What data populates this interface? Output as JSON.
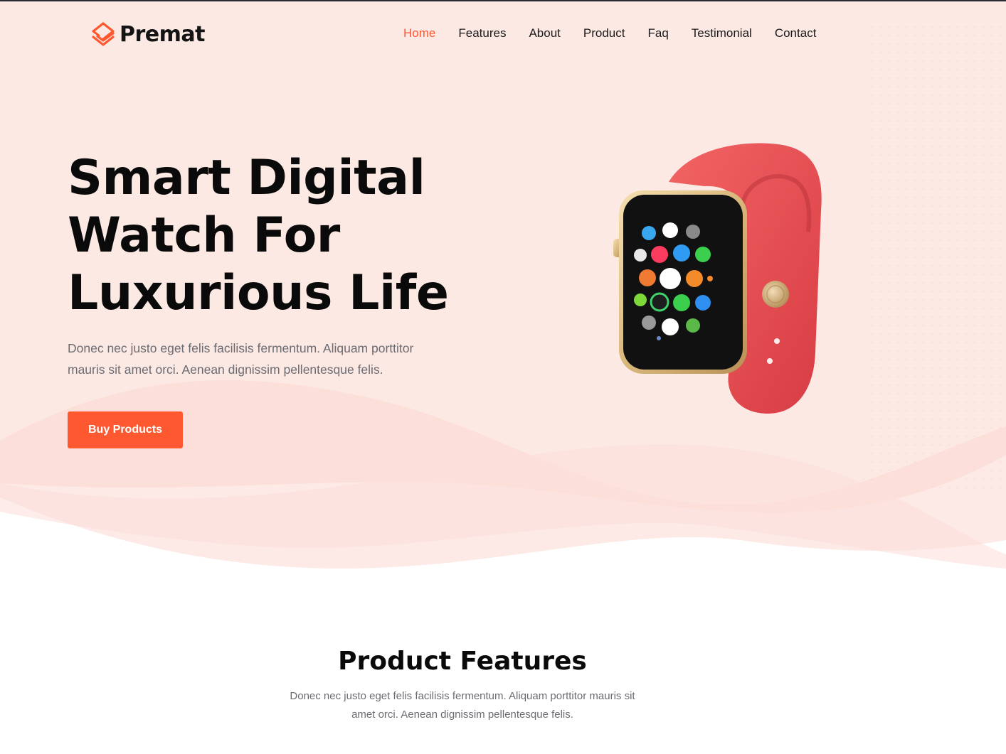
{
  "brand": {
    "name": "Premat",
    "logo_icon": "layered-diamond-logo",
    "accent_color": "#fe5830"
  },
  "nav": {
    "items": [
      {
        "label": "Home",
        "active": true
      },
      {
        "label": "Features",
        "active": false
      },
      {
        "label": "About",
        "active": false
      },
      {
        "label": "Product",
        "active": false
      },
      {
        "label": "Faq",
        "active": false
      },
      {
        "label": "Testimonial",
        "active": false
      },
      {
        "label": "Contact",
        "active": false
      }
    ]
  },
  "hero": {
    "title_lines": [
      "Smart Digital",
      "Watch For",
      "Luxurious Life"
    ],
    "description": "Donec nec justo eget felis facilisis fermentum. Aliquam porttitor mauris sit amet orci. Aenean dignissim pellentesque felis.",
    "cta_label": "Buy Products",
    "image": "smart-watch-red-band",
    "background_color": "#fde9e3"
  },
  "features": {
    "title": "Product Features",
    "description": "Donec nec justo eget felis facilisis fermentum. Aliquam porttitor mauris sit amet orci. Aenean dignissim pellentesque felis."
  }
}
